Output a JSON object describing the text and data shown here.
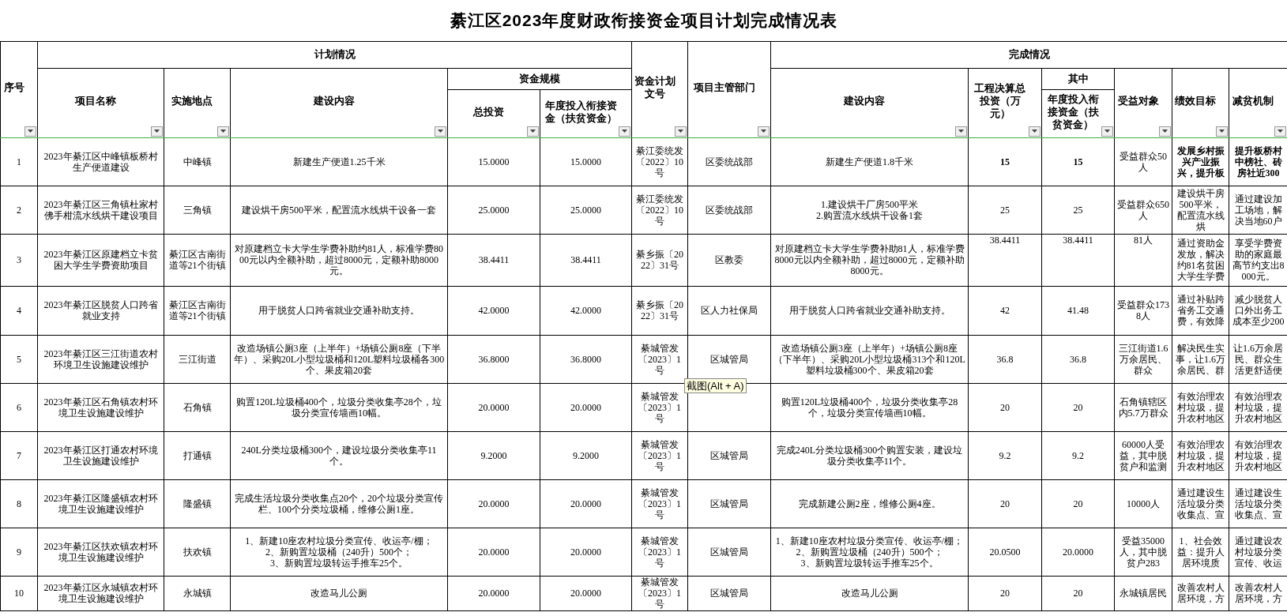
{
  "title": "綦江区2023年度财政衔接资金项目计划完成情况表",
  "groups": {
    "plan": "计划情况",
    "completion": "完成情况",
    "funding_scale": "资金规模",
    "of_which": "其中"
  },
  "columns": [
    "序号",
    "项目名称",
    "实施地点",
    "建设内容",
    "总投资",
    "年度投入衔接资金（扶贫资金）",
    "资金计划文号",
    "项目主管部门",
    "建设内容",
    "工程决算总投资（万元）",
    "年度投入衔接资金（扶贫资金）",
    "受益对象",
    "绩效目标",
    "减贫机制"
  ],
  "rows": [
    {
      "cells": [
        "1",
        "2023年綦江区中峰镇板桥村生产便道建设",
        "中峰镇",
        "新建生产便道1.25千米",
        "15.0000",
        "15.0000",
        "綦江委统发〔2022〕10号",
        "区委统战部",
        "新建生产便道1.8千米",
        {
          "text": "15",
          "bold": true
        },
        {
          "text": "15",
          "bold": true
        },
        "受益群众50人",
        {
          "text": "发展乡村振兴产业振兴，提升板",
          "bold": true
        },
        {
          "text": "提升板桥村中榜社、砖房社近300",
          "bold": true
        }
      ]
    },
    {
      "cells": [
        "2",
        "2023年綦江区三角镇杜家村佛手柑流水线烘干建设项目",
        "三角镇",
        "建设烘干房500平米，配置流水线烘干设备一套",
        "25.0000",
        "25.0000",
        "綦江委统发〔2022〕10号",
        "区委统战部",
        "1.建设烘干厂房500平米\n2.购置流水线烘干设备1套",
        "25",
        "25",
        "受益群众650人",
        "建设烘干房500平米，配置流水线烘",
        "通过建设加工场地，解决当地60户"
      ]
    },
    {
      "cells": [
        "3",
        "2023年綦江区原建档立卡贫困大学生学费资助项目",
        "綦江区古南街道等21个街镇",
        "对原建档立卡大学生学费补助约81人，标准学费8000元以内全额补助，超过8000元，定额补助8000元。",
        "38.4411",
        "38.4411",
        "綦乡振〔2022〕31号",
        "区教委",
        "对原建档立卡大学生学费补助81人，标准学费8000元以内全额补助，超过8000元，定额补助8000元。",
        {
          "text": "38.4411",
          "top": true
        },
        {
          "text": "38.4411",
          "top": true
        },
        {
          "text": "81人",
          "top": true
        },
        "通过资助金发放，解决约81名贫困大学生学费",
        "享受学费资助的家庭最高节约支出8000元。"
      ]
    },
    {
      "cells": [
        "4",
        "2023年綦江区脱贫人口跨省就业支持",
        "綦江区古南街道等21个街镇",
        "用于脱贫人口跨省就业交通补助支持。",
        "42.0000",
        "42.0000",
        "綦乡振〔2022〕31号",
        "区人力社保局",
        "用于脱贫人口跨省就业交通补助支持。",
        "42",
        "41.48",
        "受益群众1738人",
        "通过补贴跨省务工交通费，有效降",
        "减少脱贫人口外出务工成本至少200"
      ]
    },
    {
      "cells": [
        "5",
        "2023年綦江区三江街道农村环境卫生设施建设维护",
        "三江街道",
        "改造场镇公厕3座（上半年）+场镇公厕8座（下半年）、采购20L小型垃圾桶和120L塑料垃圾桶各300个、果皮箱20套",
        "36.8000",
        "36.8000",
        "綦城管发〔2023〕1号",
        "区城管局",
        "改造场镇公厕3座（上半年）+场镇公厕8座（下半年）、采购20L小型垃圾桶313个和120L塑料垃圾桶300个、果皮箱20套",
        "36.8",
        "36.8",
        "三江街道1.6万余居民、群众",
        "解决民生实事，让1.6万余居民、群",
        "让1.6万余居民、群众生活更舒适便"
      ]
    },
    {
      "cells": [
        "6",
        "2023年綦江区石角镇农村环境卫生设施建设维护",
        "石角镇",
        "购置120L垃圾桶400个，垃圾分类收集亭28个，垃圾分类宣传墙画10幅。",
        "20.0000",
        "20.0000",
        "綦城管发〔2023〕1号",
        {
          "text": "截图(Alt + A)",
          "kind": "tooltip"
        },
        "购置120L垃圾桶400个，垃圾分类收集亭28个，垃圾分类宣传墙画10幅。",
        "20",
        "20",
        "石角镇辖区内5.7万群众",
        "有效治理农村垃圾，提升农村地区",
        "有效治理农村垃圾，提升农村地区"
      ]
    },
    {
      "cells": [
        "7",
        "2023年綦江区打通农村环境卫生设施建设维护",
        "打通镇",
        "240L分类垃圾桶300个，建设垃圾分类收集亭11个。",
        "9.2000",
        "9.2000",
        "綦城管发〔2023〕1号",
        "区城管局",
        "完成240L分类垃圾桶300个购置安装，建设垃圾分类收集亭11个。",
        "9.2",
        "9.2",
        "60000人受益，其中脱贫户和监测",
        "有效治理农村垃圾，提升农村地区",
        "有效治理农村垃圾，提升农村地区"
      ]
    },
    {
      "cells": [
        "8",
        "2023年綦江区隆盛镇农村环境卫生设施建设维护",
        "隆盛镇",
        "完成生活垃圾分类收集点20个，20个垃圾分类宣传栏、100个分类垃圾桶，维修公厕1座。",
        "20.0000",
        "20.0000",
        "綦城管发〔2023〕1号",
        "区城管局",
        "完成新建公厕2座，维修公厕4座。",
        "20",
        "20",
        "10000人",
        "通过建设生活垃圾分类收集点、宣",
        "通过建设生活垃圾分类收集点、宣"
      ]
    },
    {
      "cells": [
        "9",
        "2023年綦江区扶欢镇农村环境卫生设施建设维护",
        "扶欢镇",
        "1、新建10座农村垃圾分类宣传、收运亭/棚；\n2、新购置垃圾桶（240升）500个；\n3、新购置垃圾转运手推车25个。",
        "20.0000",
        "20.0000",
        "綦城管发〔2023〕1号",
        "区城管局",
        "1、新建10座农村垃圾分类宣传、收运亭/棚；\n2、新购置垃圾桶（240升）500个；\n3、新购置垃圾转运手推车25个。",
        "20.0500",
        "20.0000",
        "受益35000人，其中脱贫户283",
        "1、社会效益：提升人居环境质",
        "通过建设农村垃圾分类宣传、收运"
      ]
    },
    {
      "cells": [
        "10",
        "2023年綦江区永城镇农村环境卫生设施建设维护",
        "永城镇",
        "改造马儿公厕",
        "20.0000",
        "20.0000",
        "綦城管发〔2023〕1号",
        "区城管局",
        "改造马儿公厕",
        "20",
        "20",
        "永城镇居民",
        "改善农村人居环境，方",
        "改善农村人居环境，方"
      ]
    }
  ]
}
